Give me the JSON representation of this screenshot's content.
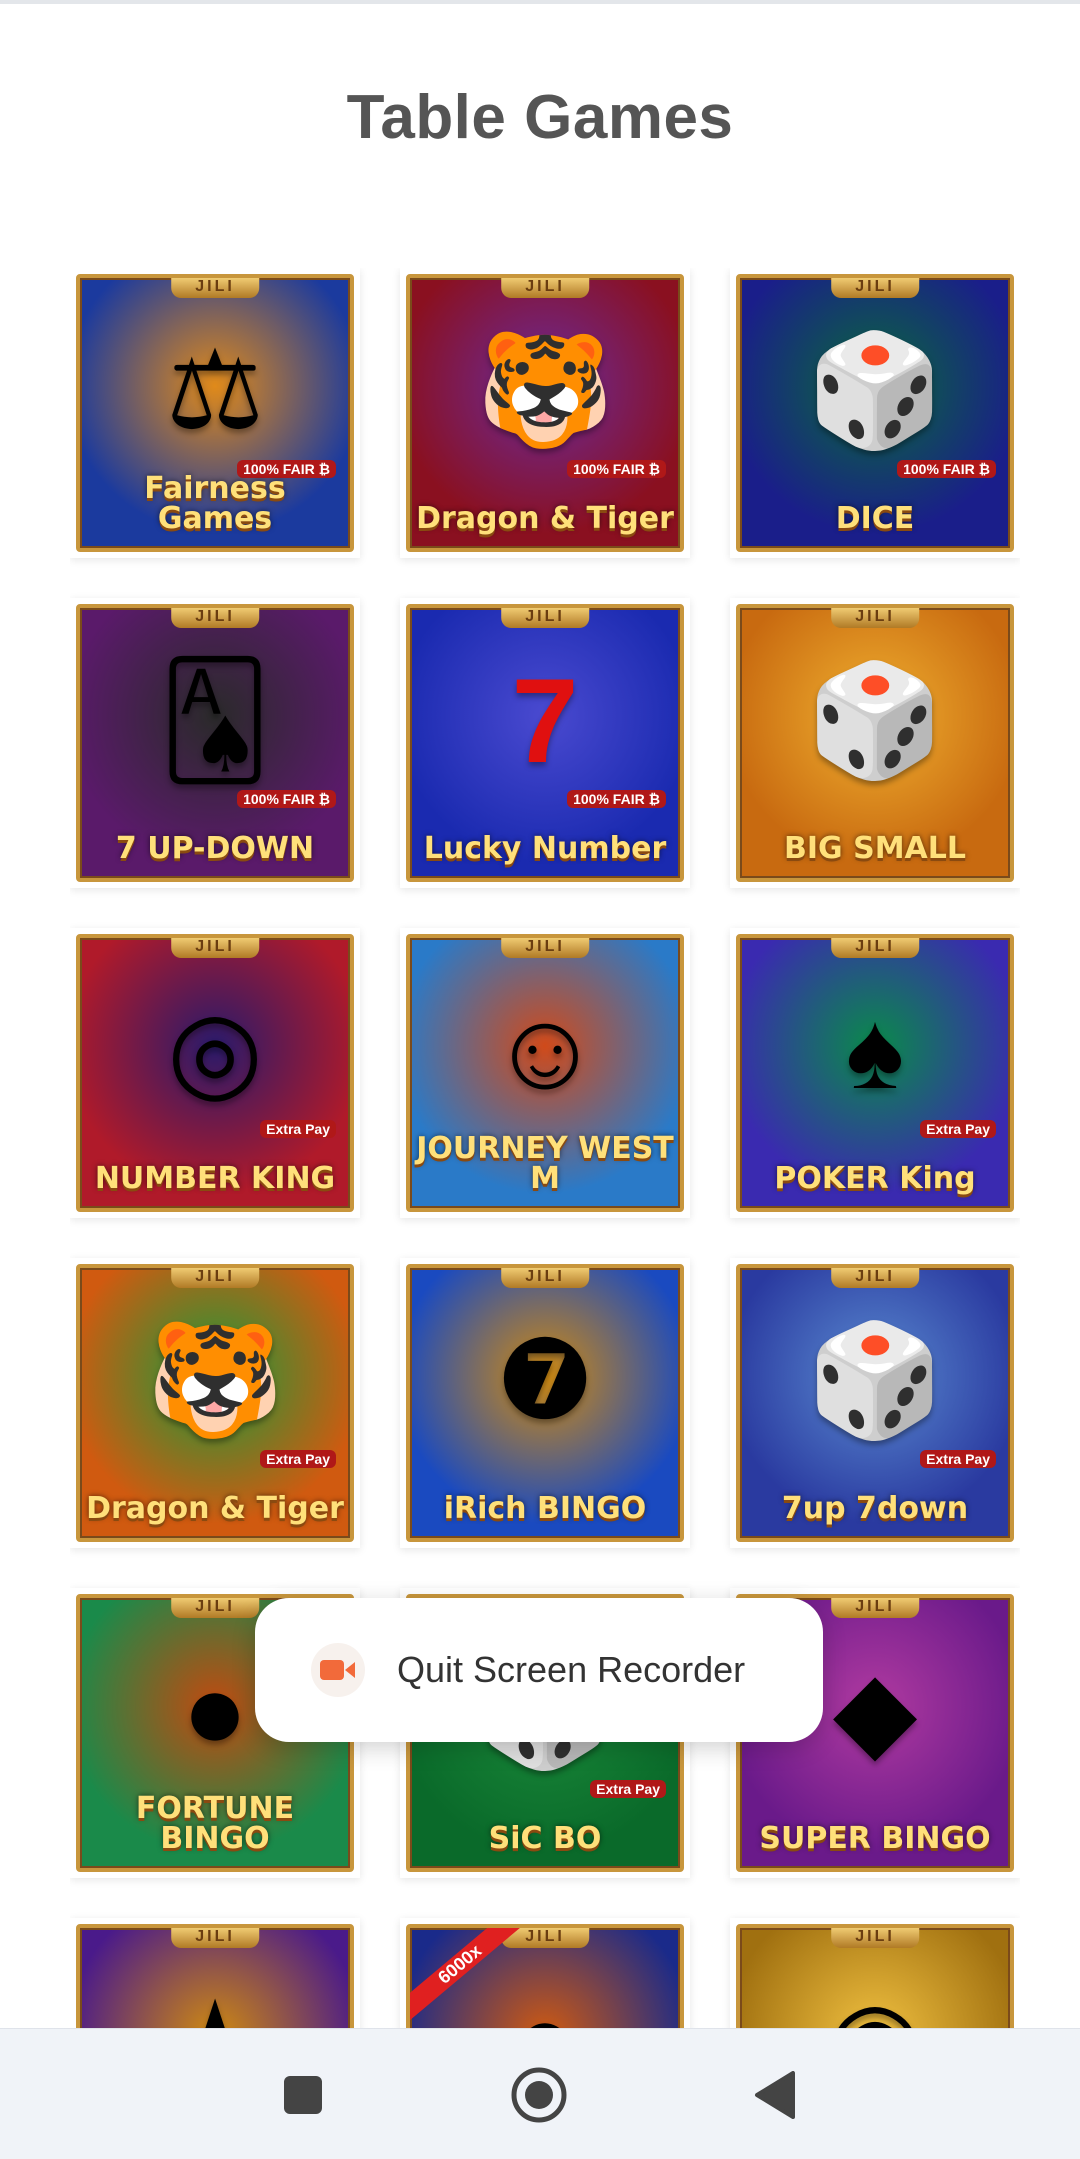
{
  "page": {
    "title": "Table Games"
  },
  "provider_badge": "JILI",
  "games": [
    {
      "title": "Fairness Games",
      "tag": "100% FAIR ₿",
      "icon": "scales-icon",
      "bg": "#1b3a9e",
      "bg2": "#e08a1a"
    },
    {
      "title": "Dragon & Tiger",
      "tag": "100% FAIR ₿",
      "icon": "tiger-dragon-icon",
      "bg": "#8a1020",
      "bg2": "#6a2a9a"
    },
    {
      "title": "DICE",
      "tag": "100% FAIR ₿",
      "icon": "dice-cup-icon",
      "bg": "#1a1e8a",
      "bg2": "#0a6a3a"
    },
    {
      "title": "7 UP-DOWN",
      "tag": "100% FAIR ₿",
      "icon": "playing-cards-icon",
      "bg": "#5a1a6a",
      "bg2": "#2a2a2a"
    },
    {
      "title": "Lucky Number",
      "tag": "100% FAIR ₿",
      "icon": "slot-79-icon",
      "bg": "#1a2ab0",
      "bg2": "#4a4ad0"
    },
    {
      "title": "BIG SMALL",
      "tag": "",
      "icon": "dice-icon",
      "bg": "#c86a10",
      "bg2": "#f0b030"
    },
    {
      "title": "NUMBER KING",
      "tag": "Extra Pay",
      "icon": "wheel-icon",
      "bg": "#b01a2a",
      "bg2": "#2a1a6a"
    },
    {
      "title": "JOURNEY WEST M",
      "tag": "",
      "icon": "monkey-king-icon",
      "bg": "#2a7ac8",
      "bg2": "#d04a1a"
    },
    {
      "title": "POKER King",
      "tag": "Extra Pay",
      "icon": "poker-wheel-icon",
      "bg": "#3a2ab0",
      "bg2": "#0a8a4a"
    },
    {
      "title": "Dragon & Tiger",
      "tag": "Extra Pay",
      "icon": "tiger-dragon-icon",
      "bg": "#d05a10",
      "bg2": "#1a9a3a"
    },
    {
      "title": "iRich BINGO",
      "tag": "",
      "icon": "bingo-ball-7-icon",
      "bg": "#1a4ac0",
      "bg2": "#d08a10"
    },
    {
      "title": "7up 7down",
      "tag": "Extra Pay",
      "icon": "dice-icon",
      "bg": "#2a3aa0",
      "bg2": "#5a8ad0"
    },
    {
      "title": "FORTUNE BINGO",
      "tag": "",
      "icon": "bingo-ball-icon",
      "bg": "#1a8a4a",
      "bg2": "#c04a10"
    },
    {
      "title": "SiC BO",
      "tag": "Extra Pay",
      "icon": "dice-icon",
      "bg": "#0a6a2a",
      "bg2": "#1a8a3a"
    },
    {
      "title": "SUPER BINGO",
      "tag": "",
      "icon": "diamond-icon",
      "bg": "#6a1a8a",
      "bg2": "#b03aa0"
    },
    {
      "title": "",
      "tag": "",
      "icon": "wheel-star-icon",
      "bg": "#4a1a8a",
      "bg2": "#d08a10"
    },
    {
      "title": "",
      "tag": "",
      "icon": "basketball-icon",
      "bg": "#1a2a8a",
      "bg2": "#d05a10",
      "ribbon": "6000x"
    },
    {
      "title": "",
      "tag": "",
      "icon": "bingo-machine-icon",
      "bg": "#a07010",
      "bg2": "#f0c040"
    }
  ],
  "toast": {
    "label": "Quit Screen Recorder",
    "icon": "video-camera-icon",
    "accent": "#f26a3a"
  },
  "navbar": {
    "icons": [
      "recents-square-icon",
      "home-circle-icon",
      "back-triangle-icon"
    ]
  }
}
